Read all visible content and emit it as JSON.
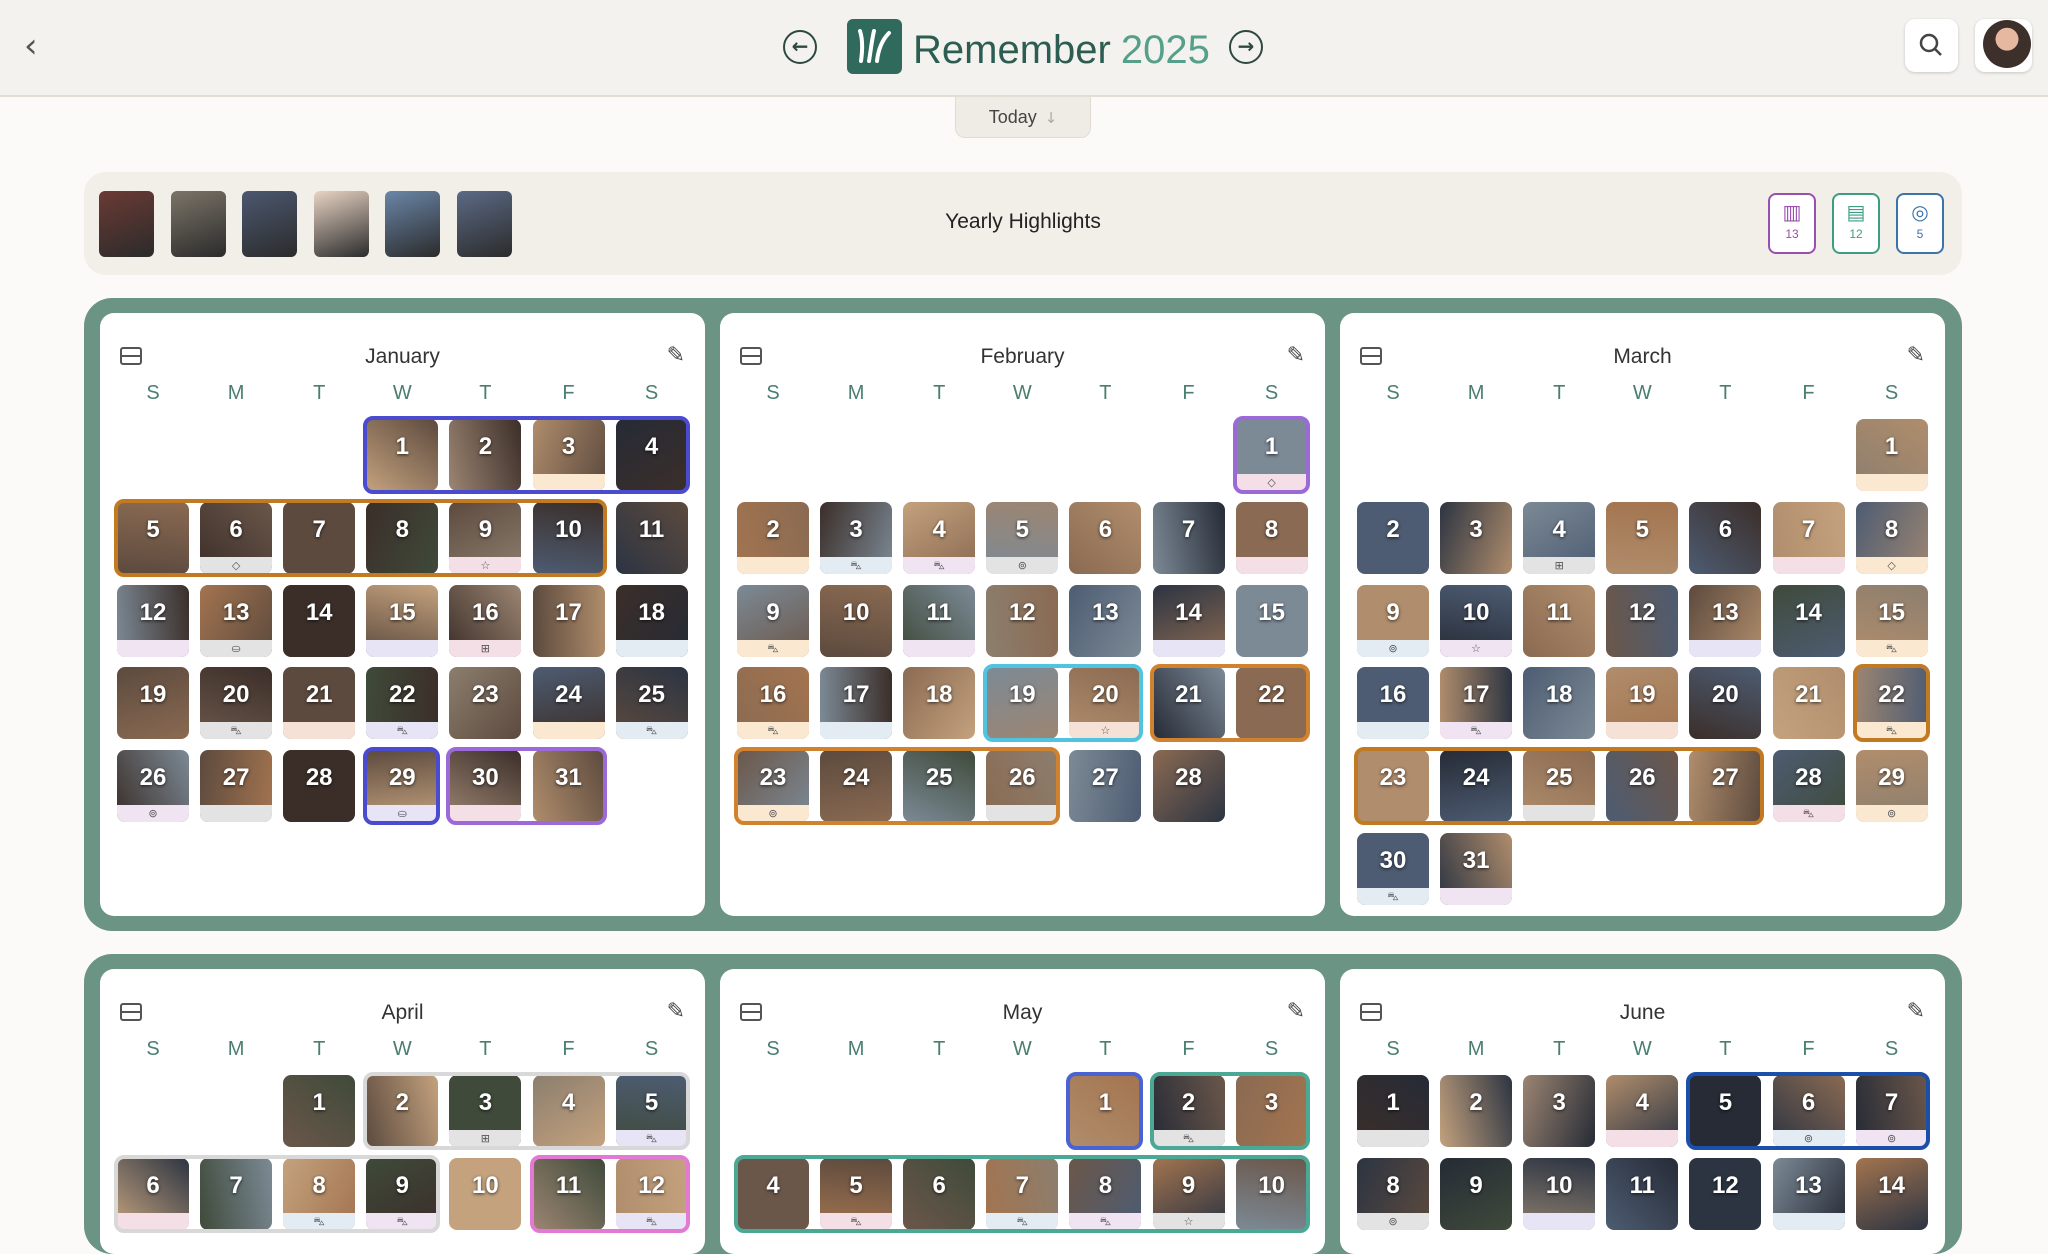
{
  "app": {
    "title": "Remember",
    "year": "2025"
  },
  "nav": {
    "back_icon": "‹",
    "prev_icon": "←",
    "next_icon": "→",
    "search_icon": "⌕"
  },
  "today": {
    "label": "Today",
    "icon": "↓"
  },
  "highlights": {
    "title": "Yearly Highlights",
    "thumb_colors": [
      "#6b3a34",
      "#7c7468",
      "#4c5870",
      "#e8d4c4",
      "#6a86a8",
      "#5c6a86"
    ],
    "badges": [
      {
        "icon": "books-icon",
        "glyph": "▥",
        "count": "13",
        "color": "#9a4fb0"
      },
      {
        "icon": "film-icon",
        "glyph": "▤",
        "count": "12",
        "color": "#3f9c84"
      },
      {
        "icon": "vinyl-icon",
        "glyph": "◎",
        "count": "5",
        "color": "#3c73a8"
      }
    ]
  },
  "weekdays": [
    "S",
    "M",
    "T",
    "W",
    "T",
    "F",
    "S"
  ],
  "months": [
    {
      "name": "January",
      "start": 3,
      "days": 31
    },
    {
      "name": "February",
      "start": 6,
      "days": 28
    },
    {
      "name": "March",
      "start": 6,
      "days": 31
    },
    {
      "name": "April",
      "start": 2,
      "days": 30
    },
    {
      "name": "May",
      "start": 4,
      "days": 31
    },
    {
      "name": "June",
      "start": 0,
      "days": 30
    }
  ],
  "day_tags": {
    "0-6": "◇",
    "0-9": "☆",
    "0-13": "⛀",
    "0-16": "⊞",
    "0-20": "⛍",
    "0-22": "⛍",
    "0-25": "⛍",
    "0-26": "⊚",
    "0-29": "⛀",
    "1-1": "◇",
    "1-3": "⛍",
    "1-4": "⛍",
    "1-5": "⊚",
    "1-9": "⛍",
    "1-16": "⛍",
    "1-20": "☆",
    "1-23": "⊚",
    "2-4": "⊞",
    "2-8": "◇",
    "2-9": "⊚",
    "2-10": "☆",
    "2-15": "⛍",
    "2-17": "⛍",
    "2-22": "⛍",
    "2-28": "⛍",
    "2-29": "⊚",
    "2-30": "⛍",
    "3-3": "⊞",
    "3-5": "⛍",
    "3-8": "⛍",
    "3-9": "⛍",
    "3-12": "⛍",
    "4-2": "⛍",
    "4-5": "⛍",
    "4-7": "⛍",
    "4-8": "⛍",
    "4-9": "☆",
    "5-6": "⊚",
    "5-7": "⊚",
    "5-8": "⊚"
  }
}
